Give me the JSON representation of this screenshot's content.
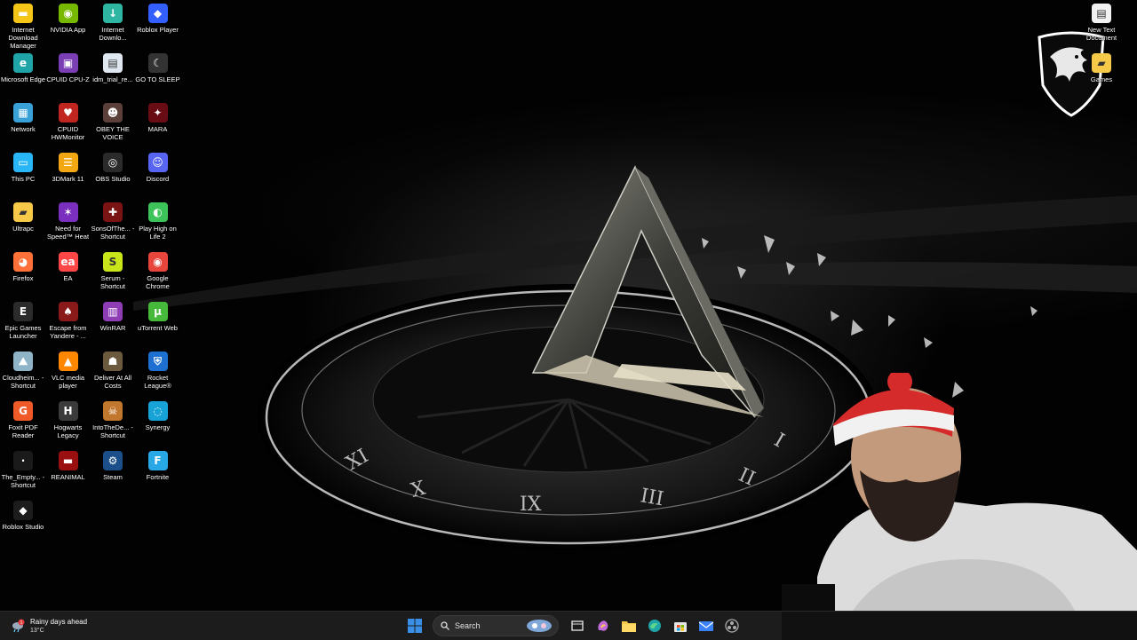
{
  "desktop": {
    "icons": [
      {
        "label": "Internet Download Manager",
        "icon": "idm-icon",
        "color": "#f5c518",
        "glyph": "▬"
      },
      {
        "label": "NVIDIA App",
        "icon": "nvidia-icon",
        "color": "#76b900",
        "glyph": "◉"
      },
      {
        "label": "Internet Downlo...",
        "icon": "edge-download-icon",
        "color": "#2fb6a3",
        "glyph": "↓"
      },
      {
        "label": "Roblox Player",
        "icon": "roblox-icon",
        "color": "#335fff",
        "glyph": "◆"
      },
      {
        "label": "Microsoft Edge",
        "icon": "edge-icon",
        "color": "#1fa5a8",
        "glyph": "e"
      },
      {
        "label": "CPUID CPU-Z",
        "icon": "cpuz-icon",
        "color": "#7a3fb5",
        "glyph": "▣"
      },
      {
        "label": "idm_trial_re...",
        "icon": "file-icon",
        "color": "#dfe8f0",
        "glyph": "▤"
      },
      {
        "label": "GO TO SLEEP",
        "icon": "sleep-shortcut-icon",
        "color": "#333333",
        "glyph": "☾"
      },
      {
        "label": "Network",
        "icon": "network-icon",
        "color": "#3aa0d8",
        "glyph": "▦"
      },
      {
        "label": "CPUID HWMonitor",
        "icon": "hwmonitor-icon",
        "color": "#c0261f",
        "glyph": "♥"
      },
      {
        "label": "OBEY THE VOICE",
        "icon": "game-icon",
        "color": "#5a4038",
        "glyph": "☻"
      },
      {
        "label": "MARA",
        "icon": "game-mara-icon",
        "color": "#6a0c14",
        "glyph": "✦"
      },
      {
        "label": "This PC",
        "icon": "this-pc-icon",
        "color": "#29b6f6",
        "glyph": "▭"
      },
      {
        "label": "3DMark 11",
        "icon": "3dmark-icon",
        "color": "#f3a712",
        "glyph": "☰"
      },
      {
        "label": "OBS Studio",
        "icon": "obs-icon",
        "color": "#2a2a2a",
        "glyph": "◎"
      },
      {
        "label": "Discord",
        "icon": "discord-icon",
        "color": "#5865f2",
        "glyph": "☺"
      },
      {
        "label": "Ultrapc",
        "icon": "folder-icon",
        "color": "#f7c948",
        "glyph": "▰"
      },
      {
        "label": "Need for Speed™ Heat",
        "icon": "nfs-heat-icon",
        "color": "#7b2fbe",
        "glyph": "✶"
      },
      {
        "label": "SonsOfThe... - Shortcut",
        "icon": "sons-forest-icon",
        "color": "#7a1414",
        "glyph": "✚"
      },
      {
        "label": "Play High on Life 2",
        "icon": "high-on-life-icon",
        "color": "#3cc45a",
        "glyph": "◐"
      },
      {
        "label": "Firefox",
        "icon": "firefox-icon",
        "color": "#ff7139",
        "glyph": "◕"
      },
      {
        "label": "EA",
        "icon": "ea-icon",
        "color": "#ff4747",
        "glyph": "ea"
      },
      {
        "label": "Serum - Shortcut",
        "icon": "serum-icon",
        "color": "#c8e61a",
        "glyph": "S"
      },
      {
        "label": "Google Chrome",
        "icon": "chrome-icon",
        "color": "#e8453c",
        "glyph": "◉"
      },
      {
        "label": "Epic Games Launcher",
        "icon": "epic-icon",
        "color": "#2b2b2b",
        "glyph": "E"
      },
      {
        "label": "Escape from Yandere - ...",
        "icon": "yandere-icon",
        "color": "#8a1a1a",
        "glyph": "♠"
      },
      {
        "label": "WinRAR",
        "icon": "winrar-icon",
        "color": "#8e3db5",
        "glyph": "▥"
      },
      {
        "label": "uTorrent Web",
        "icon": "utorrent-icon",
        "color": "#46b93b",
        "glyph": "µ"
      },
      {
        "label": "Cloudheim... - Shortcut",
        "icon": "cloudheim-icon",
        "color": "#8fb4c8",
        "glyph": "⛰"
      },
      {
        "label": "VLC media player",
        "icon": "vlc-icon",
        "color": "#ff8800",
        "glyph": "▲"
      },
      {
        "label": "Deliver At All Costs",
        "icon": "deliver-icon",
        "color": "#6b5a3e",
        "glyph": "☗"
      },
      {
        "label": "Rocket League®",
        "icon": "rocket-league-icon",
        "color": "#1d6fd1",
        "glyph": "⛨"
      },
      {
        "label": "Foxit PDF Reader",
        "icon": "foxit-icon",
        "color": "#f05a28",
        "glyph": "G"
      },
      {
        "label": "Hogwarts Legacy",
        "icon": "hogwarts-icon",
        "color": "#3b3b3b",
        "glyph": "H"
      },
      {
        "label": "IntoTheDe... - Shortcut",
        "icon": "into-the-dead-icon",
        "color": "#c2772e",
        "glyph": "☠"
      },
      {
        "label": "Synergy",
        "icon": "synergy-icon",
        "color": "#17a2d8",
        "glyph": "◌"
      },
      {
        "label": "The_Empty... - Shortcut",
        "icon": "empty-game-icon",
        "color": "#1a1a1a",
        "glyph": "·"
      },
      {
        "label": "REANIMAL",
        "icon": "reanimal-icon",
        "color": "#9a1010",
        "glyph": "▬"
      },
      {
        "label": "Steam",
        "icon": "steam-icon",
        "color": "#1b4f8a",
        "glyph": "⚙"
      },
      {
        "label": "Fortnite",
        "icon": "fortnite-icon",
        "color": "#29a8e8",
        "glyph": "F"
      },
      {
        "label": "Roblox Studio",
        "icon": "roblox-studio-icon",
        "color": "#1c1c1c",
        "glyph": "◆"
      },
      {
        "label": "New Text Document",
        "icon": "text-document-icon",
        "color": "#f2f2f2",
        "glyph": "▤"
      },
      {
        "label": "Games",
        "icon": "folder-games-icon",
        "color": "#f7c948",
        "glyph": "▰"
      }
    ]
  },
  "wallpaper": {
    "numerals": [
      "XI",
      "X",
      "IX",
      "III",
      "II",
      "I"
    ]
  },
  "taskbar": {
    "weather_title": "Rainy days ahead",
    "weather_temp": "13°C",
    "weather_badge": "1",
    "search_label": "Search",
    "apps": [
      {
        "name": "start-button",
        "icon": "windows-start-icon",
        "color": "#3a8ee6"
      },
      {
        "name": "task-view-button",
        "icon": "task-view-icon",
        "color": "#dddddd"
      },
      {
        "name": "copilot-button",
        "icon": "copilot-icon",
        "color": "#c06bd9"
      },
      {
        "name": "file-explorer-button",
        "icon": "folder-icon",
        "color": "#f7c948"
      },
      {
        "name": "edge-button",
        "icon": "edge-icon",
        "color": "#1fa5a8"
      },
      {
        "name": "store-button",
        "icon": "store-icon",
        "color": "#e5e5e5"
      },
      {
        "name": "mail-button",
        "icon": "mail-icon",
        "color": "#3b82f6"
      },
      {
        "name": "obs-button",
        "icon": "obs-icon",
        "color": "#aaaaaa"
      }
    ]
  }
}
